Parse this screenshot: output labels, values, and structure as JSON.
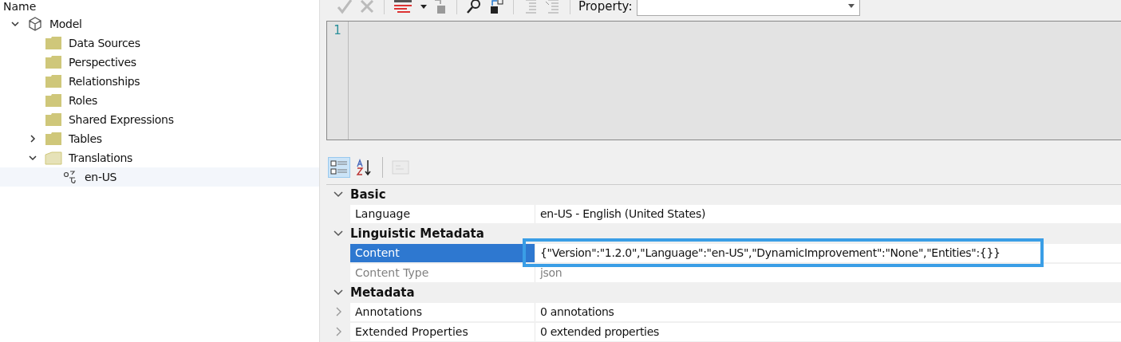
{
  "tree": {
    "header": "Name",
    "items": [
      {
        "label": "Model",
        "kind": "model",
        "expanded": true,
        "selected": false,
        "children": [
          {
            "label": "Data Sources",
            "kind": "folder",
            "selected": false
          },
          {
            "label": "Perspectives",
            "kind": "folder",
            "selected": false
          },
          {
            "label": "Relationships",
            "kind": "folder",
            "selected": false
          },
          {
            "label": "Roles",
            "kind": "folder",
            "selected": false
          },
          {
            "label": "Shared Expressions",
            "kind": "folder",
            "selected": false
          },
          {
            "label": "Tables",
            "kind": "folder",
            "expanded": false,
            "selected": false
          },
          {
            "label": "Translations",
            "kind": "folder",
            "expanded": true,
            "selected": false,
            "children": [
              {
                "label": "en-US",
                "kind": "translation",
                "selected": true
              }
            ]
          }
        ]
      }
    ]
  },
  "editor_toolbar": {
    "property_label": "Property:"
  },
  "editor": {
    "line_numbers": [
      "1"
    ]
  },
  "grid_toolbar": [
    {
      "kind": "categorized",
      "selected": true,
      "disabled": false
    },
    {
      "kind": "alphabetical",
      "selected": false,
      "disabled": false
    },
    {
      "kind": "pages",
      "selected": false,
      "disabled": true
    }
  ],
  "properties": [
    {
      "category": "Basic",
      "expanded": true,
      "rows": [
        {
          "name": "Language",
          "value": "en-US - English (United States)",
          "selected": false,
          "disabled": false
        }
      ]
    },
    {
      "category": "Linguistic Metadata",
      "expanded": true,
      "rows": [
        {
          "name": "Content",
          "value": "{\"Version\":\"1.2.0\",\"Language\":\"en-US\",\"DynamicImprovement\":\"None\",\"Entities\":{}}",
          "selected": true,
          "disabled": false,
          "highlighted": true
        },
        {
          "name": "Content Type",
          "value": "json",
          "selected": false,
          "disabled": true
        }
      ]
    },
    {
      "category": "Metadata",
      "expanded": true,
      "rows": [
        {
          "name": "Annotations",
          "value": "0 annotations",
          "selected": false,
          "disabled": false,
          "expanded": false
        },
        {
          "name": "Extended Properties",
          "value": "0 extended properties",
          "selected": false,
          "disabled": false,
          "expanded": false
        }
      ]
    }
  ]
}
